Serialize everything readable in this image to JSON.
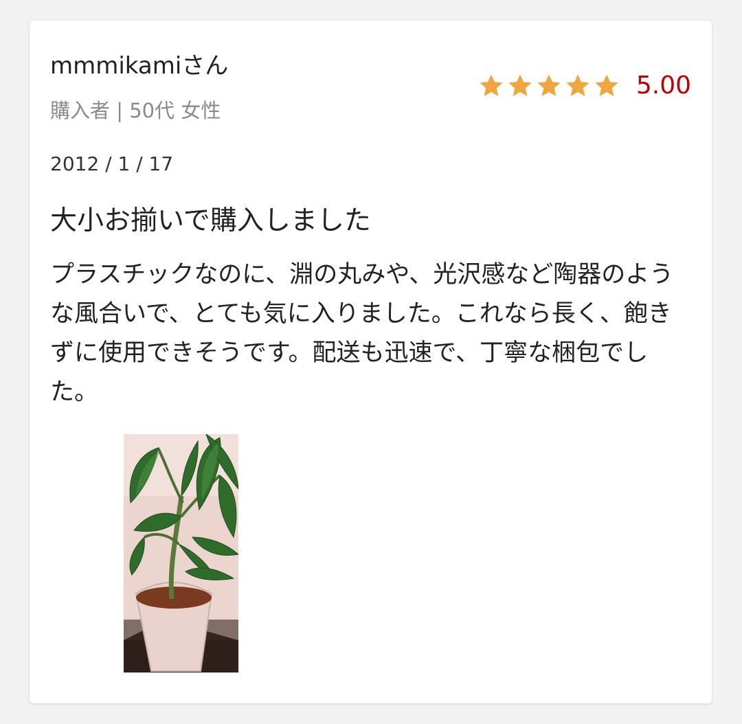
{
  "review": {
    "username": "mmmikamiさん",
    "reviewer_meta": "購入者 | 50代 女性",
    "rating": {
      "stars": 5,
      "score": "5.00",
      "star_color": "#f0a640",
      "score_color": "#bf0000"
    },
    "date": "2012 / 1 / 17",
    "title": "大小お揃いで購入しました",
    "body": "プラスチックなのに、淵の丸みや、光沢感など陶器のような風合いで、とても気に入りました。これなら長く、飽きずに使用できそうです。配送も迅速で、丁寧な梱包でした。"
  }
}
